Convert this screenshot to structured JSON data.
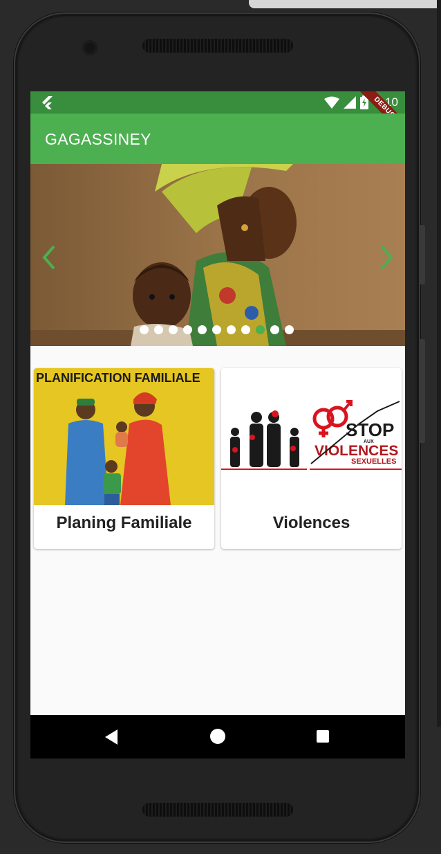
{
  "status_bar": {
    "time": "3:10",
    "debug_label": "DEBUG",
    "icons": [
      "flutter-icon",
      "wifi-icon",
      "signal-icon",
      "battery-charging-icon"
    ]
  },
  "app_bar": {
    "title": "GAGASSINEY",
    "color": "#4caf50",
    "status_color": "#388e3c"
  },
  "carousel": {
    "dot_count": 11,
    "active_index": 8,
    "prev_icon": "chevron-left-icon",
    "next_icon": "chevron-right-icon"
  },
  "cards": [
    {
      "label": "Planing Familiale",
      "image_text": "PLANIFICATION FAMILIALE"
    },
    {
      "label": "Violences",
      "image_text_stop": "STOP",
      "image_text_aux": "AUX",
      "image_text_main": "VIOLENCES",
      "image_text_sub": "SEXUELLES"
    }
  ],
  "nav_bar": {
    "icons": [
      "back-icon",
      "home-icon",
      "recent-apps-icon"
    ]
  }
}
